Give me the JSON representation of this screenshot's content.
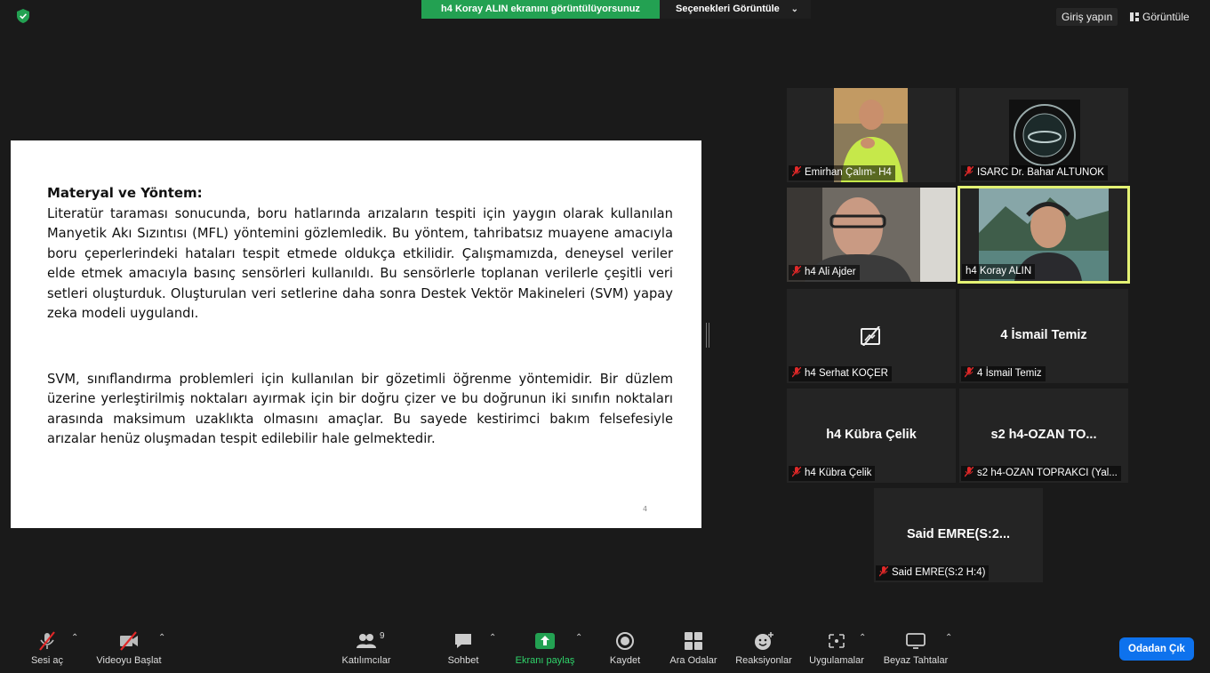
{
  "topbar": {
    "share_banner": "h4 Koray ALIN ekranını görüntülüyorsunuz",
    "view_options": "Seçenekleri Görüntüle",
    "signin": "Giriş yapın",
    "view": "Görüntüle"
  },
  "slide": {
    "heading": "Materyal ve Yöntem:",
    "paragraph1": "Literatür taraması sonucunda, boru hatlarında arızaların tespiti için yaygın olarak kullanılan Manyetik Akı Sızıntısı (MFL) yöntemini gözlemledik. Bu yöntem, tahribatsız muayene amacıyla boru çeperlerindeki hataları tespit etmede oldukça etkilidir. Çalışmamızda, deneysel veriler elde etmek amacıyla basınç sensörleri kullanıldı. Bu sensörlerle toplanan verilerle çeşitli veri setleri oluşturduk. Oluşturulan veri setlerine daha sonra Destek Vektör Makineleri (SVM) yapay zeka modeli uygulandı.",
    "paragraph2": "SVM, sınıflandırma problemleri için kullanılan bir gözetimli öğrenme yöntemidir. Bir düzlem üzerine yerleştirilmiş noktaları ayırmak için bir doğru çizer ve bu doğrunun iki sınıfın noktaları arasında maksimum uzaklıkta olmasını amaçlar. Bu sayede kestirimci bakım felsefesiyle arızalar henüz oluşmadan tespit edilebilir hale gelmektedir.",
    "page_number": "4"
  },
  "participants": [
    {
      "name": "Emirhan Çalım- H4",
      "big": ""
    },
    {
      "name": "ISARC Dr. Bahar ALTUNOK",
      "big": ""
    },
    {
      "name": "h4 Ali Ajder",
      "big": ""
    },
    {
      "name": "h4 Koray ALIN",
      "big": ""
    },
    {
      "name": "h4 Serhat KOÇER",
      "big": ""
    },
    {
      "name": "4 İsmail Temiz",
      "big": "4 İsmail Temiz"
    },
    {
      "name": "h4 Kübra Çelik",
      "big": "h4 Kübra Çelik"
    },
    {
      "name": "s2 h4-OZAN TOPRAKCI (Yal...",
      "big": "s2 h4-OZAN TO..."
    },
    {
      "name": "Said EMRE(S:2 H:4)",
      "big": "Said  EMRE(S:2..."
    }
  ],
  "toolbar": {
    "unmute": "Sesi aç",
    "start_video": "Videoyu Başlat",
    "participants": "Katılımcılar",
    "participants_count": "9",
    "chat": "Sohbet",
    "share_screen": "Ekranı paylaş",
    "record": "Kaydet",
    "breakout": "Ara Odalar",
    "reactions": "Reaksiyonlar",
    "apps": "Uygulamalar",
    "whiteboard": "Beyaz Tahtalar",
    "leave": "Odadan Çık"
  },
  "colors": {
    "share_green": "#23a152",
    "active_speaker_border": "#e4f274",
    "leave_blue": "#0e72ed",
    "muted_red": "#e02828"
  }
}
